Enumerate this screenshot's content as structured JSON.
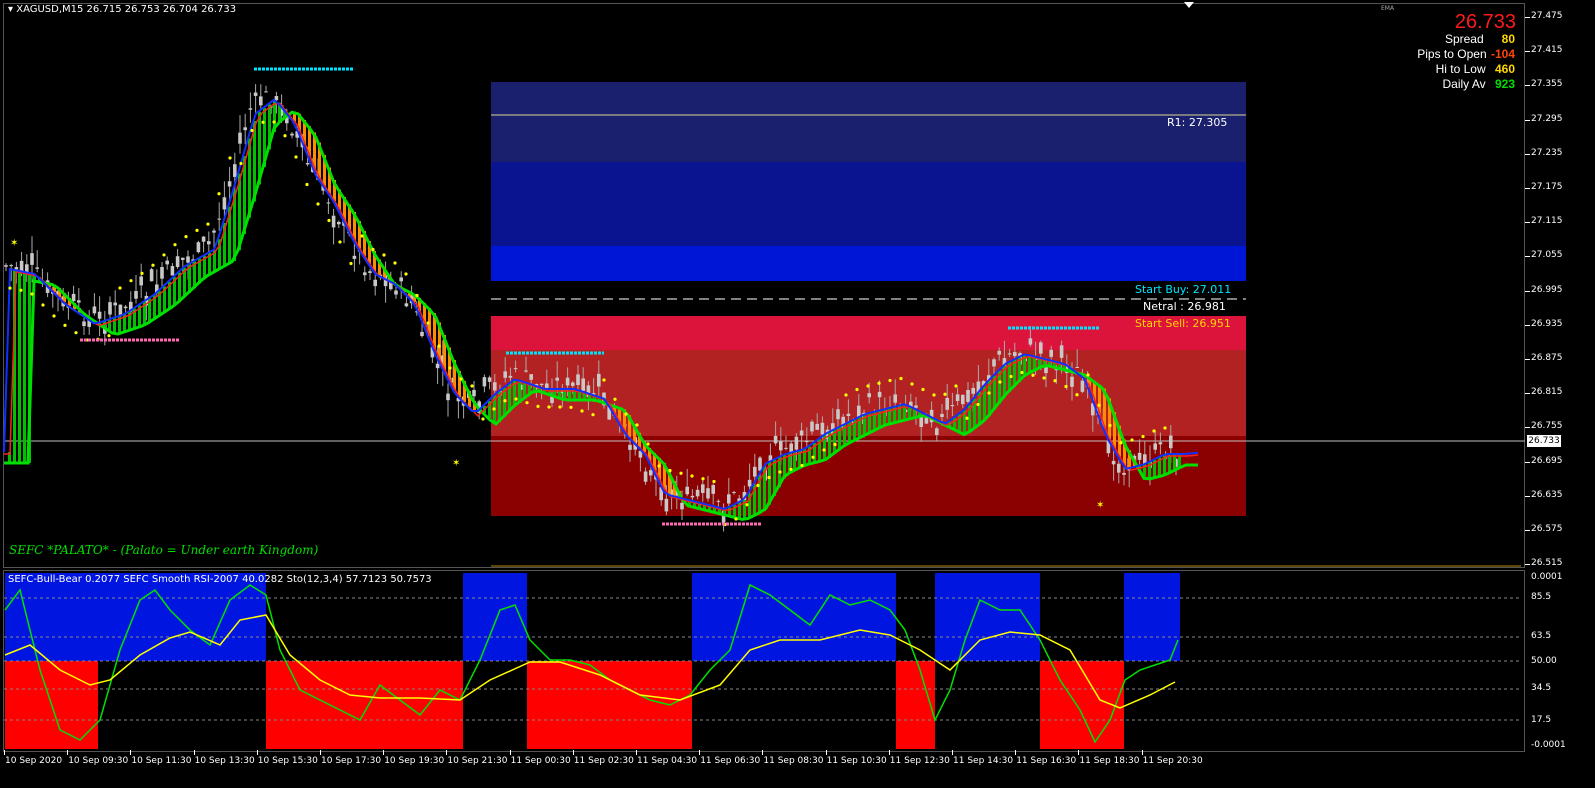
{
  "main_chart": {
    "header": "XAGUSD,M15  26.715 26.753 26.704 26.733",
    "ema_label": "EMA",
    "watermark": "SEFC *PALATO* - (Palato = Under earth Kingdom)",
    "current_price": "26.733",
    "r1_label": "R1: 27.305",
    "start_buy_label": "Start Buy: 27.011",
    "netral_label": "Netral : 26.981",
    "start_sell_label": "Start Sell: 26.951",
    "price_axis": [
      "27.475",
      "27.415",
      "27.355",
      "27.295",
      "27.235",
      "27.175",
      "27.115",
      "27.055",
      "26.995",
      "26.935",
      "26.875",
      "26.815",
      "26.755",
      "26.695",
      "26.635",
      "26.575",
      "26.515"
    ]
  },
  "info_panel": {
    "price": "26.733",
    "spread_label": "Spread",
    "spread_value": "80",
    "pips_label": "Pips to Open",
    "pips_value": "-104",
    "hilo_label": "Hi to Low",
    "hilo_value": "460",
    "daily_label": "Daily Av",
    "daily_value": "923"
  },
  "sub_chart": {
    "header": "SEFC-Bull-Bear 0.2077  SEFC Smooth RSI-2007 40.0282  Sto(12,3,4) 57.7123 50.7573",
    "axis": [
      "0.0001",
      "85.5",
      "63.5",
      "50.00",
      "34.5",
      "17.5",
      "-0.0001"
    ]
  },
  "time_axis": [
    "10 Sep 2020",
    "10 Sep 09:30",
    "10 Sep 11:30",
    "10 Sep 13:30",
    "10 Sep 15:30",
    "10 Sep 17:30",
    "10 Sep 19:30",
    "10 Sep 21:30",
    "11 Sep 00:30",
    "11 Sep 02:30",
    "11 Sep 04:30",
    "11 Sep 06:30",
    "11 Sep 08:30",
    "11 Sep 10:30",
    "11 Sep 12:30",
    "11 Sep 14:30",
    "11 Sep 16:30",
    "11 Sep 18:30",
    "11 Sep 20:30"
  ],
  "colors": {
    "bg": "#000000",
    "bull": "#0000ff",
    "bear": "#ff0000",
    "sma_green": "#00e000",
    "rsi_yellow": "#ffff00",
    "zone_r1_top": "#1a1f6e",
    "zone_blue_dark": "#0a1490",
    "zone_blue": "#0016d6",
    "zone_crimson": "#dc143c",
    "zone_red": "#b22222",
    "zone_dark_red": "#8b0000"
  }
}
